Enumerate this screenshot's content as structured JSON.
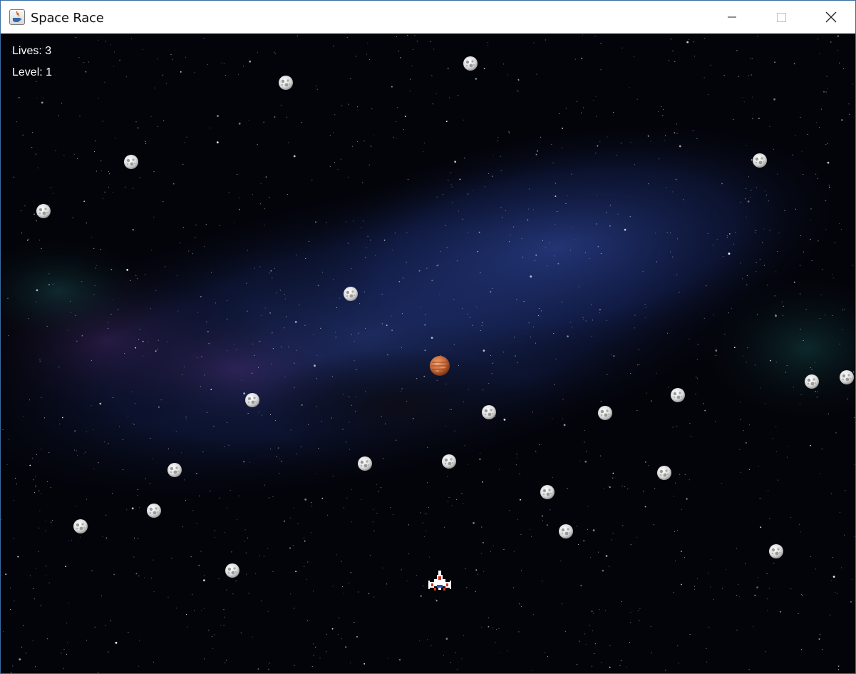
{
  "window": {
    "title": "Space Race",
    "controls": [
      "minimize",
      "maximize",
      "close"
    ]
  },
  "hud": {
    "lives_text": "Lives: 3",
    "level_text": "Level: 1"
  },
  "game": {
    "asteroid_count": 24,
    "player": {
      "icon": "spaceship-icon"
    },
    "bonus_planet": {
      "icon": "planet-icon",
      "color": "#c8693a"
    },
    "colors": {
      "space": "#03040a",
      "nebula": "#1b2a66",
      "asteroid": "#d8d8d8"
    }
  }
}
